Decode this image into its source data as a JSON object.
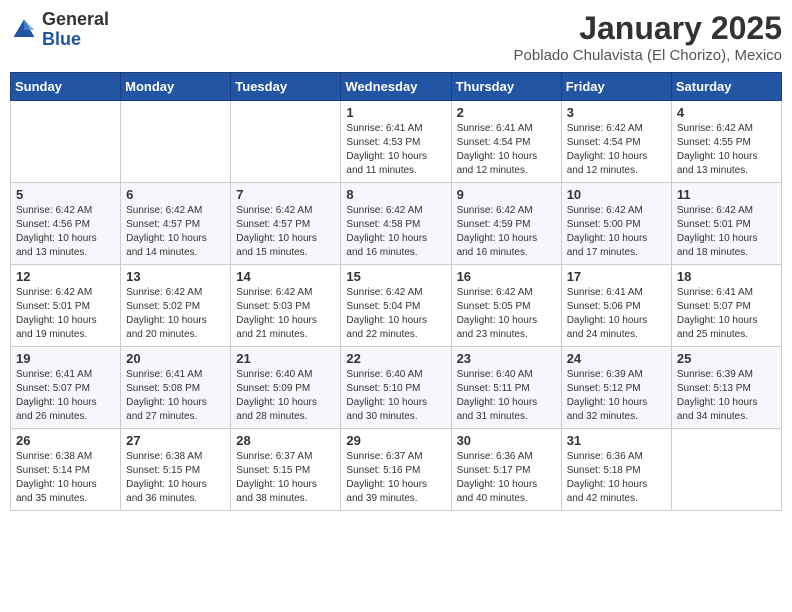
{
  "logo": {
    "general": "General",
    "blue": "Blue"
  },
  "title": "January 2025",
  "subtitle": "Poblado Chulavista (El Chorizo), Mexico",
  "weekdays": [
    "Sunday",
    "Monday",
    "Tuesday",
    "Wednesday",
    "Thursday",
    "Friday",
    "Saturday"
  ],
  "weeks": [
    [
      {
        "day": "",
        "sunrise": "",
        "sunset": "",
        "daylight": ""
      },
      {
        "day": "",
        "sunrise": "",
        "sunset": "",
        "daylight": ""
      },
      {
        "day": "",
        "sunrise": "",
        "sunset": "",
        "daylight": ""
      },
      {
        "day": "1",
        "sunrise": "Sunrise: 6:41 AM",
        "sunset": "Sunset: 4:53 PM",
        "daylight": "Daylight: 10 hours and 11 minutes."
      },
      {
        "day": "2",
        "sunrise": "Sunrise: 6:41 AM",
        "sunset": "Sunset: 4:54 PM",
        "daylight": "Daylight: 10 hours and 12 minutes."
      },
      {
        "day": "3",
        "sunrise": "Sunrise: 6:42 AM",
        "sunset": "Sunset: 4:54 PM",
        "daylight": "Daylight: 10 hours and 12 minutes."
      },
      {
        "day": "4",
        "sunrise": "Sunrise: 6:42 AM",
        "sunset": "Sunset: 4:55 PM",
        "daylight": "Daylight: 10 hours and 13 minutes."
      }
    ],
    [
      {
        "day": "5",
        "sunrise": "Sunrise: 6:42 AM",
        "sunset": "Sunset: 4:56 PM",
        "daylight": "Daylight: 10 hours and 13 minutes."
      },
      {
        "day": "6",
        "sunrise": "Sunrise: 6:42 AM",
        "sunset": "Sunset: 4:57 PM",
        "daylight": "Daylight: 10 hours and 14 minutes."
      },
      {
        "day": "7",
        "sunrise": "Sunrise: 6:42 AM",
        "sunset": "Sunset: 4:57 PM",
        "daylight": "Daylight: 10 hours and 15 minutes."
      },
      {
        "day": "8",
        "sunrise": "Sunrise: 6:42 AM",
        "sunset": "Sunset: 4:58 PM",
        "daylight": "Daylight: 10 hours and 16 minutes."
      },
      {
        "day": "9",
        "sunrise": "Sunrise: 6:42 AM",
        "sunset": "Sunset: 4:59 PM",
        "daylight": "Daylight: 10 hours and 16 minutes."
      },
      {
        "day": "10",
        "sunrise": "Sunrise: 6:42 AM",
        "sunset": "Sunset: 5:00 PM",
        "daylight": "Daylight: 10 hours and 17 minutes."
      },
      {
        "day": "11",
        "sunrise": "Sunrise: 6:42 AM",
        "sunset": "Sunset: 5:01 PM",
        "daylight": "Daylight: 10 hours and 18 minutes."
      }
    ],
    [
      {
        "day": "12",
        "sunrise": "Sunrise: 6:42 AM",
        "sunset": "Sunset: 5:01 PM",
        "daylight": "Daylight: 10 hours and 19 minutes."
      },
      {
        "day": "13",
        "sunrise": "Sunrise: 6:42 AM",
        "sunset": "Sunset: 5:02 PM",
        "daylight": "Daylight: 10 hours and 20 minutes."
      },
      {
        "day": "14",
        "sunrise": "Sunrise: 6:42 AM",
        "sunset": "Sunset: 5:03 PM",
        "daylight": "Daylight: 10 hours and 21 minutes."
      },
      {
        "day": "15",
        "sunrise": "Sunrise: 6:42 AM",
        "sunset": "Sunset: 5:04 PM",
        "daylight": "Daylight: 10 hours and 22 minutes."
      },
      {
        "day": "16",
        "sunrise": "Sunrise: 6:42 AM",
        "sunset": "Sunset: 5:05 PM",
        "daylight": "Daylight: 10 hours and 23 minutes."
      },
      {
        "day": "17",
        "sunrise": "Sunrise: 6:41 AM",
        "sunset": "Sunset: 5:06 PM",
        "daylight": "Daylight: 10 hours and 24 minutes."
      },
      {
        "day": "18",
        "sunrise": "Sunrise: 6:41 AM",
        "sunset": "Sunset: 5:07 PM",
        "daylight": "Daylight: 10 hours and 25 minutes."
      }
    ],
    [
      {
        "day": "19",
        "sunrise": "Sunrise: 6:41 AM",
        "sunset": "Sunset: 5:07 PM",
        "daylight": "Daylight: 10 hours and 26 minutes."
      },
      {
        "day": "20",
        "sunrise": "Sunrise: 6:41 AM",
        "sunset": "Sunset: 5:08 PM",
        "daylight": "Daylight: 10 hours and 27 minutes."
      },
      {
        "day": "21",
        "sunrise": "Sunrise: 6:40 AM",
        "sunset": "Sunset: 5:09 PM",
        "daylight": "Daylight: 10 hours and 28 minutes."
      },
      {
        "day": "22",
        "sunrise": "Sunrise: 6:40 AM",
        "sunset": "Sunset: 5:10 PM",
        "daylight": "Daylight: 10 hours and 30 minutes."
      },
      {
        "day": "23",
        "sunrise": "Sunrise: 6:40 AM",
        "sunset": "Sunset: 5:11 PM",
        "daylight": "Daylight: 10 hours and 31 minutes."
      },
      {
        "day": "24",
        "sunrise": "Sunrise: 6:39 AM",
        "sunset": "Sunset: 5:12 PM",
        "daylight": "Daylight: 10 hours and 32 minutes."
      },
      {
        "day": "25",
        "sunrise": "Sunrise: 6:39 AM",
        "sunset": "Sunset: 5:13 PM",
        "daylight": "Daylight: 10 hours and 34 minutes."
      }
    ],
    [
      {
        "day": "26",
        "sunrise": "Sunrise: 6:38 AM",
        "sunset": "Sunset: 5:14 PM",
        "daylight": "Daylight: 10 hours and 35 minutes."
      },
      {
        "day": "27",
        "sunrise": "Sunrise: 6:38 AM",
        "sunset": "Sunset: 5:15 PM",
        "daylight": "Daylight: 10 hours and 36 minutes."
      },
      {
        "day": "28",
        "sunrise": "Sunrise: 6:37 AM",
        "sunset": "Sunset: 5:15 PM",
        "daylight": "Daylight: 10 hours and 38 minutes."
      },
      {
        "day": "29",
        "sunrise": "Sunrise: 6:37 AM",
        "sunset": "Sunset: 5:16 PM",
        "daylight": "Daylight: 10 hours and 39 minutes."
      },
      {
        "day": "30",
        "sunrise": "Sunrise: 6:36 AM",
        "sunset": "Sunset: 5:17 PM",
        "daylight": "Daylight: 10 hours and 40 minutes."
      },
      {
        "day": "31",
        "sunrise": "Sunrise: 6:36 AM",
        "sunset": "Sunset: 5:18 PM",
        "daylight": "Daylight: 10 hours and 42 minutes."
      },
      {
        "day": "",
        "sunrise": "",
        "sunset": "",
        "daylight": ""
      }
    ]
  ]
}
